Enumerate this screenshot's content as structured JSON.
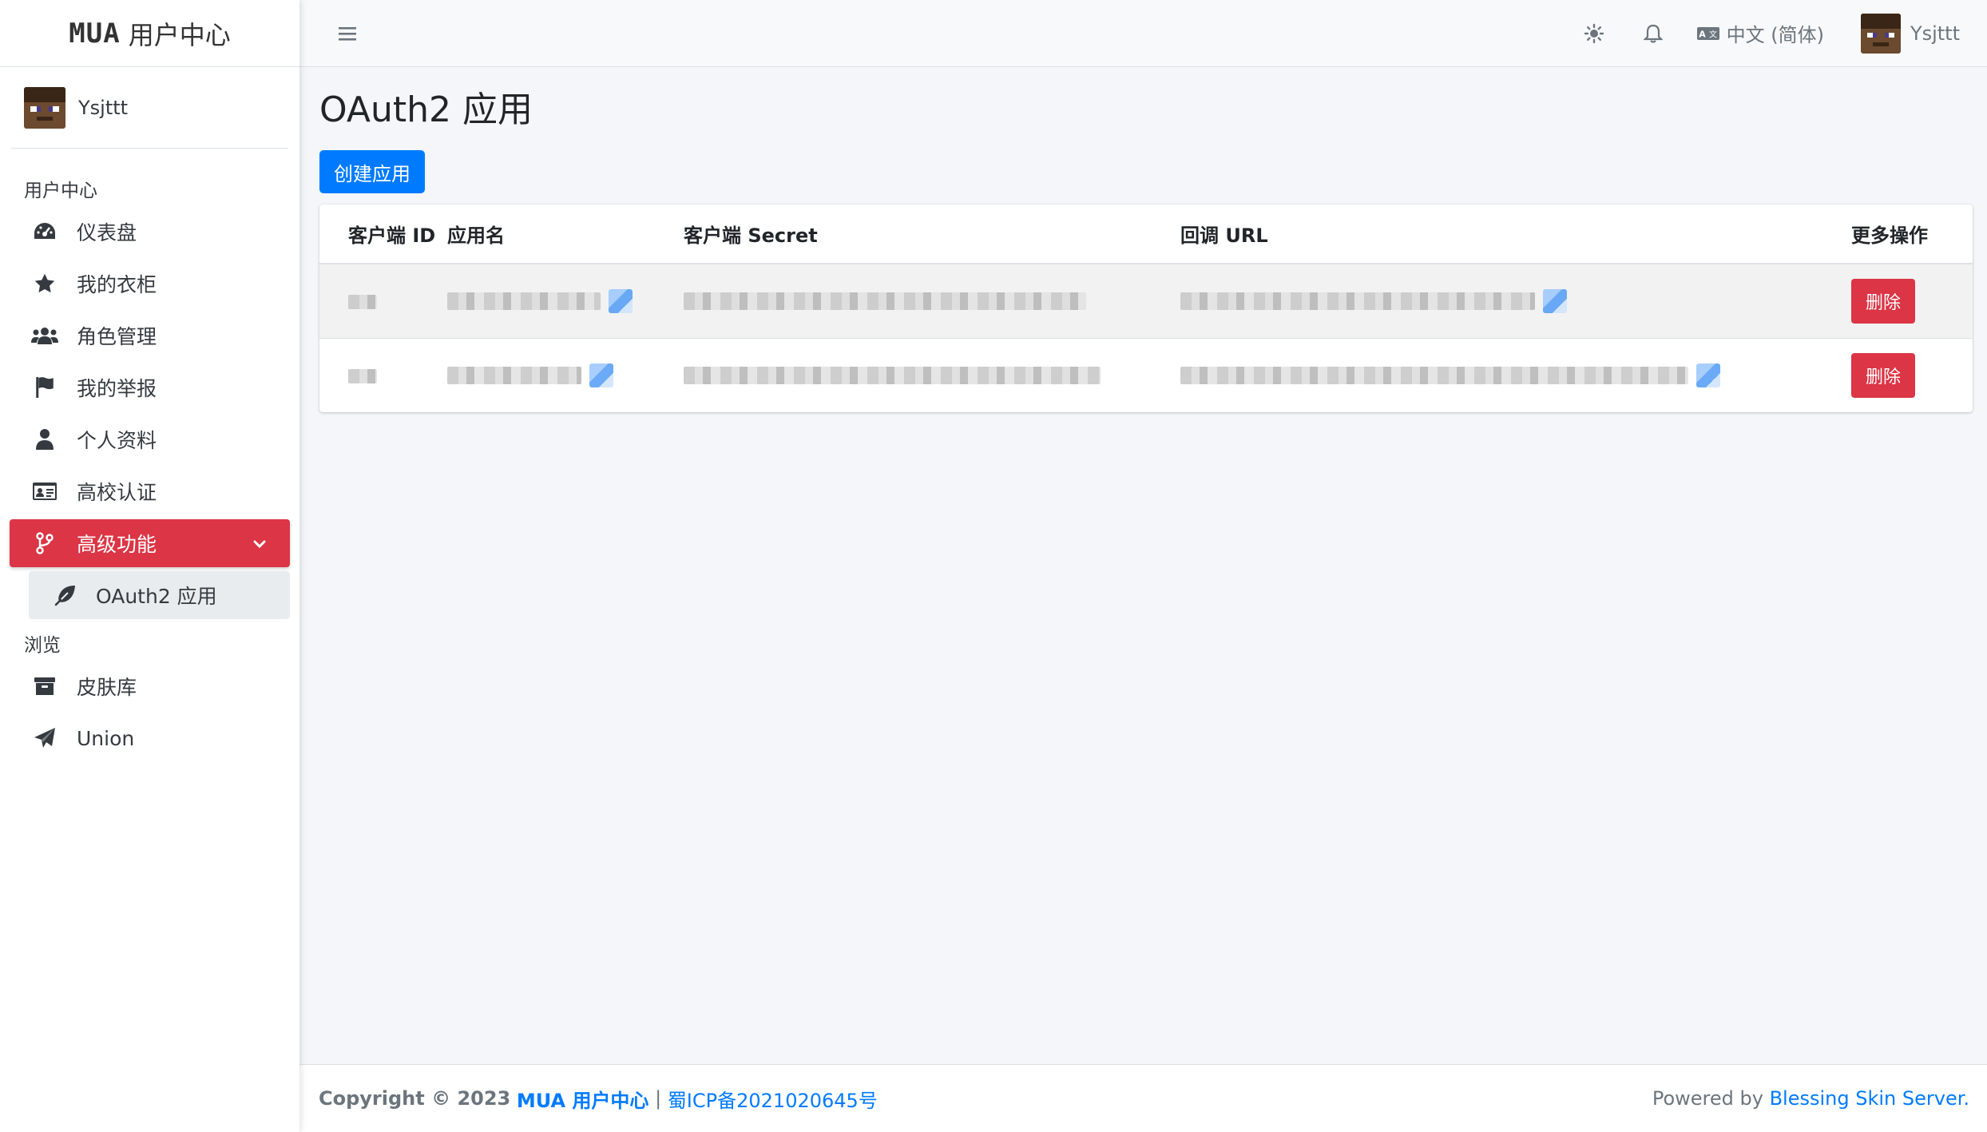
{
  "brand": {
    "logo": "MUA",
    "name": "用户中心"
  },
  "user": {
    "name": "Ysjttt"
  },
  "sidebar": {
    "header_user_center": "用户中心",
    "items": [
      {
        "label": "仪表盘",
        "icon": "dashboard-icon"
      },
      {
        "label": "我的衣柜",
        "icon": "star-icon"
      },
      {
        "label": "角色管理",
        "icon": "users-icon"
      },
      {
        "label": "我的举报",
        "icon": "flag-icon"
      },
      {
        "label": "个人资料",
        "icon": "user-icon"
      },
      {
        "label": "高校认证",
        "icon": "id-card-icon"
      },
      {
        "label": "高级功能",
        "icon": "code-branch-icon",
        "active": true
      }
    ],
    "sub_item": {
      "label": "OAuth2 应用",
      "icon": "feather-icon"
    },
    "header_browse": "浏览",
    "browse_items": [
      {
        "label": "皮肤库",
        "icon": "archive-icon"
      },
      {
        "label": "Union",
        "icon": "paper-plane-icon"
      }
    ]
  },
  "topbar": {
    "language": "中文 (简体)",
    "username": "Ysjttt"
  },
  "page": {
    "title": "OAuth2 应用",
    "create_button": "创建应用"
  },
  "table": {
    "headers": [
      "客户端 ID",
      "应用名",
      "客户端 Secret",
      "回调 URL",
      "更多操作"
    ],
    "delete_label": "删除"
  },
  "footer": {
    "copyright": "Copyright © 2023",
    "site_name": "MUA 用户中心",
    "separator": "|",
    "icp": "蜀ICP备2021020645号",
    "powered_by": "Powered by",
    "powered_link": "Blessing Skin Server."
  },
  "colors": {
    "primary": "#007bff",
    "danger": "#dc3545",
    "background": "#f4f6f9"
  }
}
